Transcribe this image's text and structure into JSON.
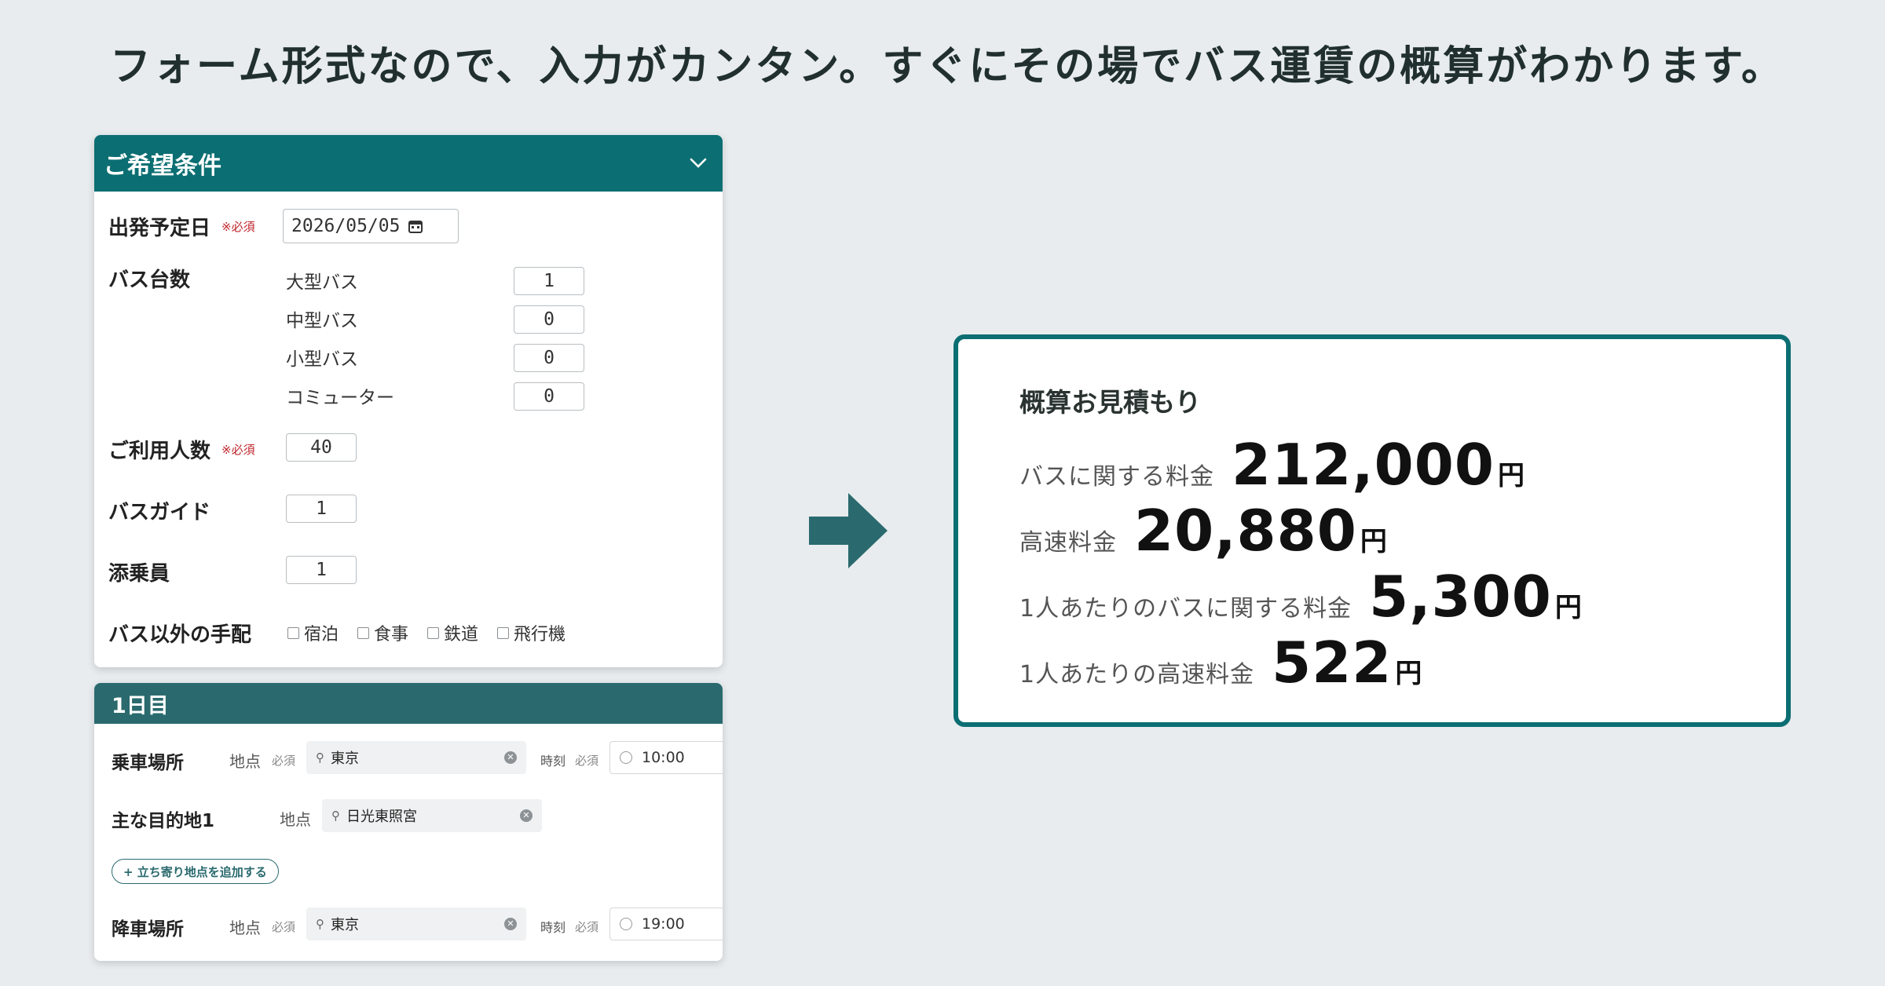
{
  "headline": "フォーム形式なので、入力がカンタン。すぐにその場でバス運賃の概算がわかります。",
  "conditions": {
    "title": "ご希望条件",
    "required": "※必須",
    "departure_label": "出発予定日",
    "departure_date": "2026/05/05",
    "bus_count_label": "バス台数",
    "bus_types": [
      {
        "label": "大型バス",
        "value": "1"
      },
      {
        "label": "中型バス",
        "value": "0"
      },
      {
        "label": "小型バス",
        "value": "0"
      },
      {
        "label": "コミューター",
        "value": "0"
      }
    ],
    "passengers_label": "ご利用人数",
    "passengers": "40",
    "guide_label": "バスガイド",
    "guide": "1",
    "attendant_label": "添乗員",
    "attendant": "1",
    "other_label": "バス以外の手配",
    "other_options": [
      "宿泊",
      "食事",
      "鉄道",
      "飛行機"
    ]
  },
  "day1": {
    "title": "1日目",
    "place_label": "地点",
    "required": "必須",
    "time_label": "時刻",
    "pickup_label": "乗車場所",
    "pickup_place": "東京",
    "pickup_time": "10:00",
    "dest_label": "主な目的地1",
    "dest_place": "日光東照宮",
    "add_stop": "+ 立ち寄り地点を追加する",
    "dropoff_label": "降車場所",
    "dropoff_place": "東京",
    "dropoff_time": "19:00"
  },
  "estimate": {
    "title": "概算お見積もり",
    "unit": "円",
    "rows": [
      {
        "label": "バスに関する料金",
        "value": "212,000"
      },
      {
        "label": "高速料金",
        "value": "20,880"
      },
      {
        "label": "1人あたりのバスに関する料金",
        "value": "5,300"
      },
      {
        "label": "1人あたりの高速料金",
        "value": "522"
      }
    ]
  },
  "colors": {
    "accent": "#0b6e72",
    "section": "#2a6a6e",
    "required": "#c0262d"
  },
  "icons": [
    "chevron-down-icon",
    "calendar-icon",
    "search-icon",
    "clear-icon",
    "clock-icon",
    "arrow-right-icon"
  ]
}
